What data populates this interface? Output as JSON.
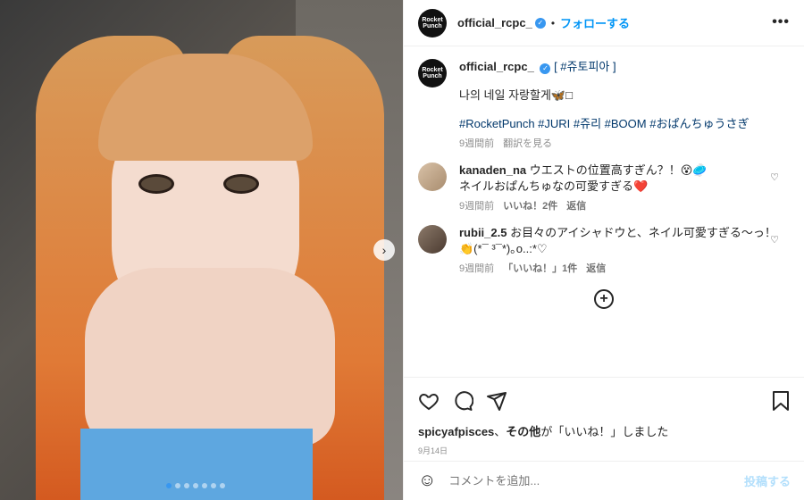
{
  "author": {
    "username": "official_rcpc_",
    "avatar_text": "Rocket\nPunch",
    "separator": "•",
    "follow_label": "フォローする"
  },
  "caption": {
    "title": "[ #쥬토피아 ]",
    "body": "나의 네일 자랑할게🦋□",
    "hashtags": "#RocketPunch #JURI #쥬리 #BOOM #おぱんちゅうさぎ",
    "time": "9週間前",
    "translate": "翻訳を見る"
  },
  "comments": [
    {
      "username": "kanaden_na",
      "text": "ウエストの位置高すぎん？！😵🥏\nネイルおぱんちゅなの可愛すぎる❤️",
      "time": "9週間前",
      "likes": "いいね！2件",
      "reply": "返信"
    },
    {
      "username": "rubii_2.5",
      "text": "お目々のアイシャドウと、ネイル可愛すぎる〜っ！👏(*¯ ³¯*)｡o..:*♡",
      "time": "9週間前",
      "likes": "「いいね！」1件",
      "reply": "返信"
    }
  ],
  "likes_text": {
    "user": "spicyafpisces",
    "rest_bold": "その他",
    "rest": "が「いいね！」しました"
  },
  "date": "9月14日",
  "add_comment": {
    "placeholder": "コメントを追加...",
    "post_label": "投稿する"
  },
  "icons": {
    "more": "more-options-icon",
    "like": "heart-icon",
    "comment": "comment-icon",
    "share": "share-icon",
    "save": "bookmark-icon",
    "next": "chevron-right-icon",
    "emoji": "emoji-icon",
    "load_more": "plus-circle-icon"
  },
  "carousel": {
    "slides": 7,
    "active_index": 0
  },
  "colors": {
    "link": "#0095f6",
    "verified": "#3897f0",
    "hashtag": "#00376b",
    "muted": "#8e8e8e"
  }
}
